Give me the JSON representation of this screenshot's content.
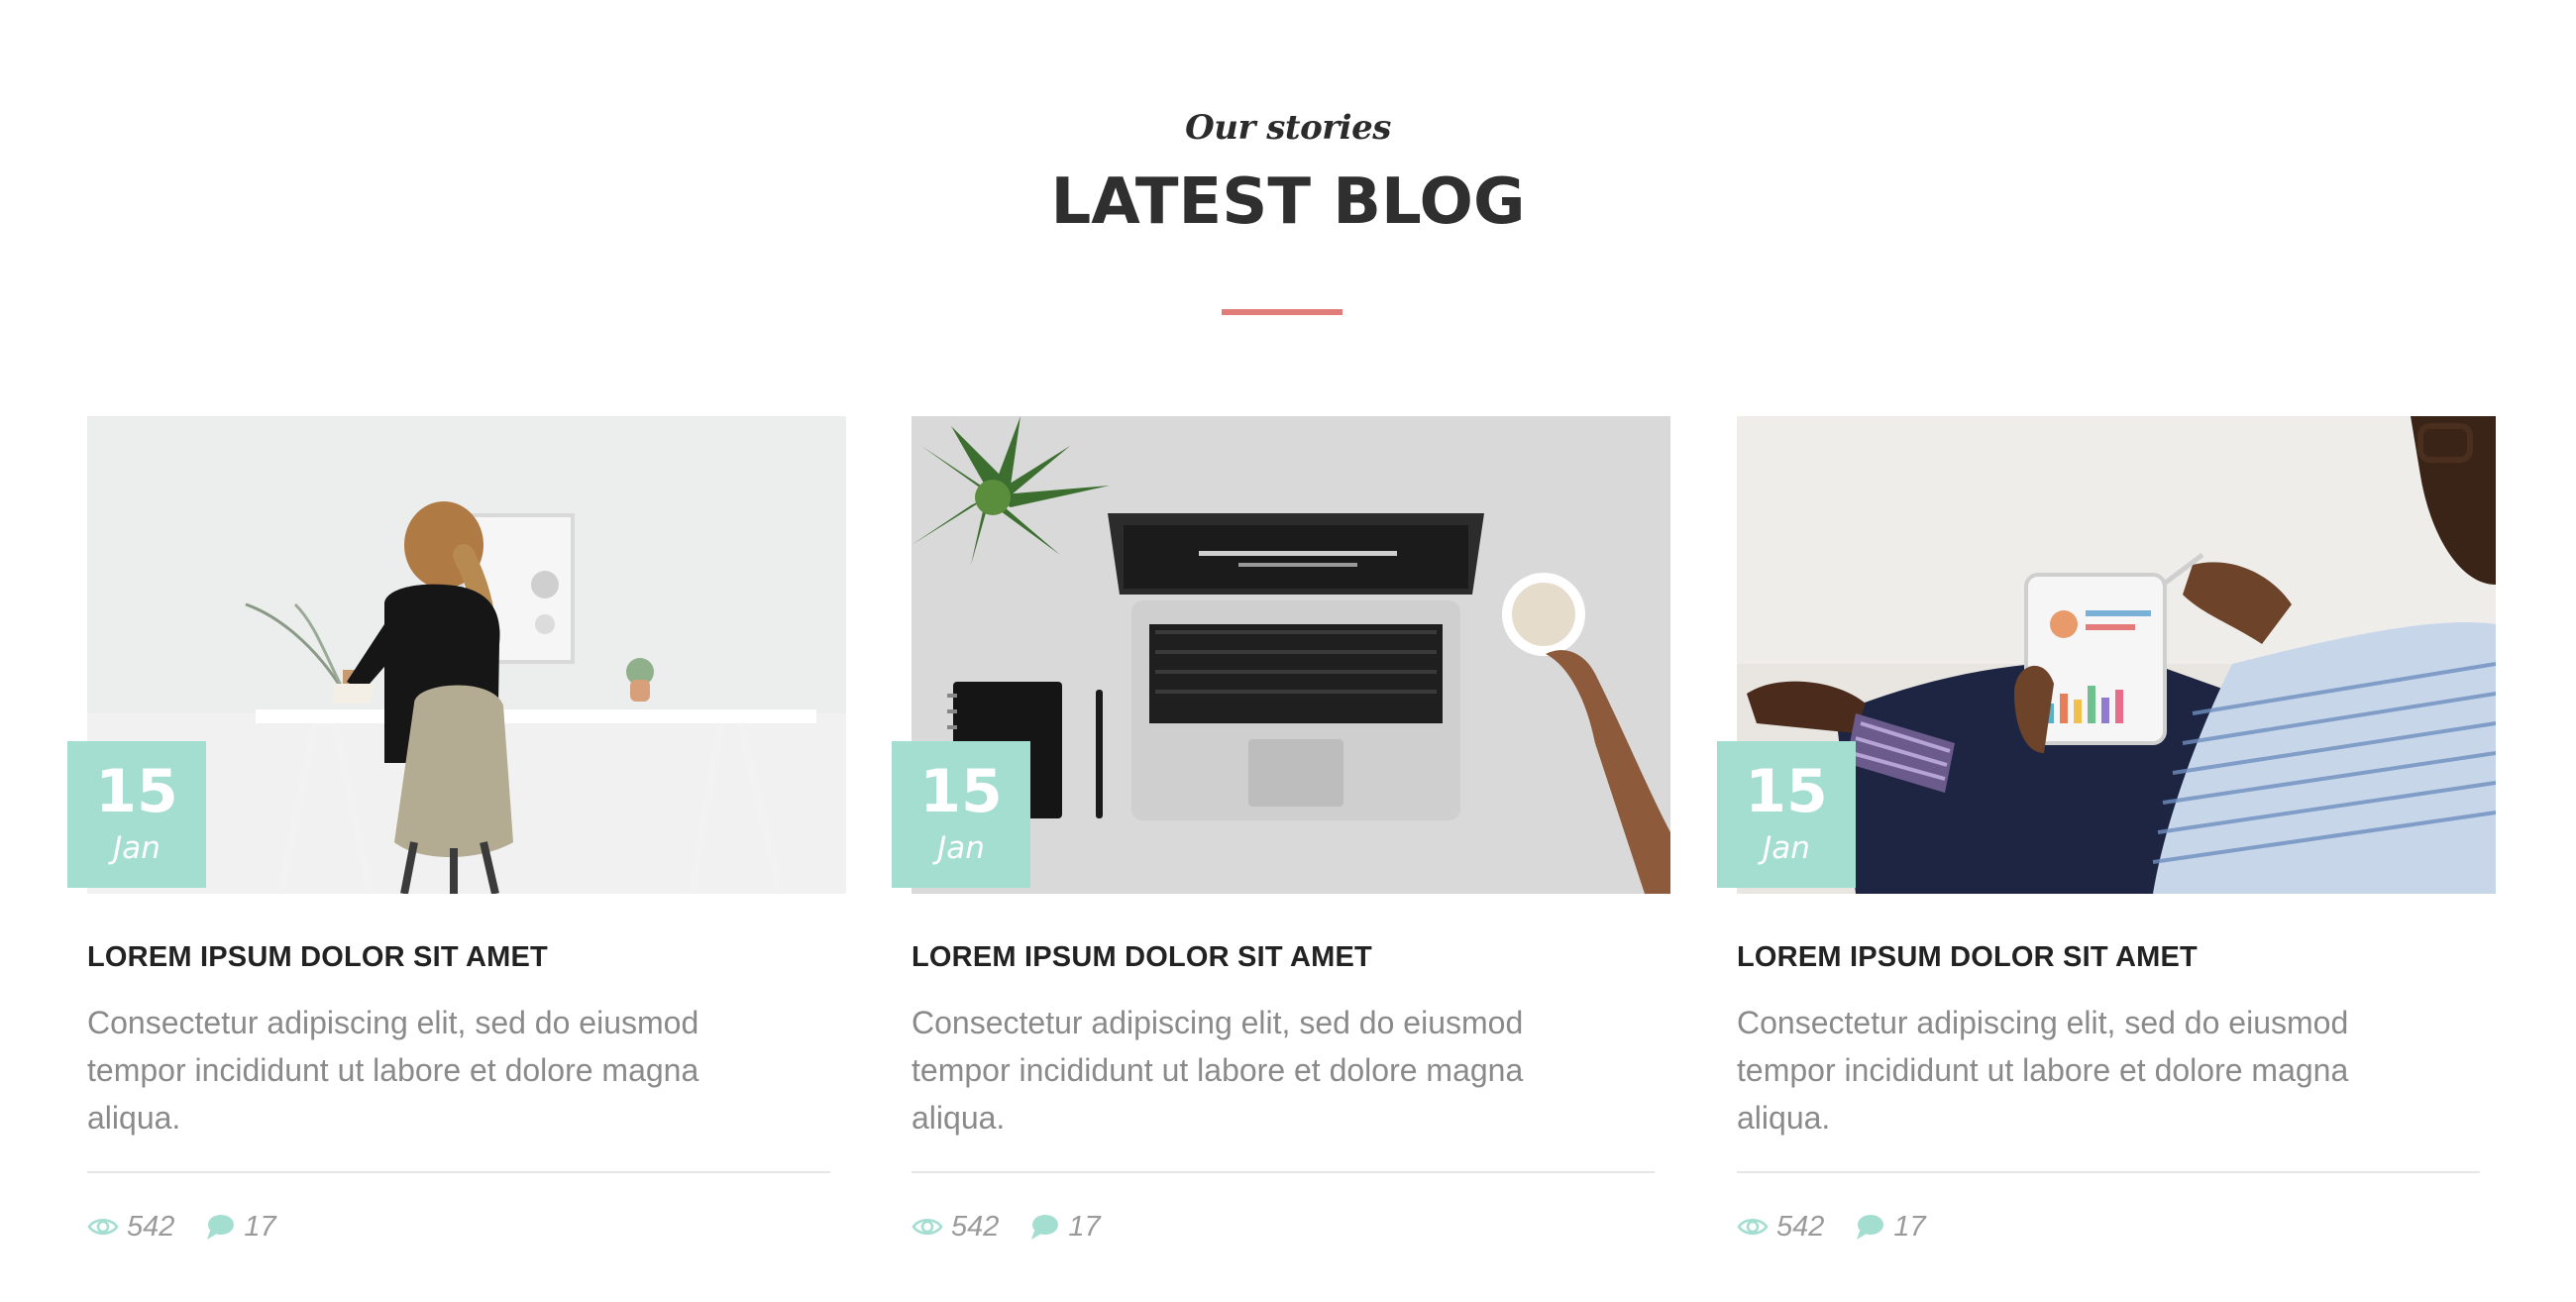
{
  "section": {
    "kicker": "Our stories",
    "title": "LATEST BLOG",
    "accent_color": "#e07d78",
    "badge_color": "#a4ded1"
  },
  "posts": [
    {
      "image": "woman-at-desk-photo",
      "date_day": "15",
      "date_month": "Jan",
      "title": "LOREM IPSUM DOLOR SIT AMET",
      "excerpt": "Consectetur adipiscing elit, sed do eiusmod tempor incididunt ut labore et dolore magna aliqua.",
      "views": "542",
      "comments": "17"
    },
    {
      "image": "laptop-on-desk-photo",
      "date_day": "15",
      "date_month": "Jan",
      "title": "LOREM IPSUM DOLOR SIT AMET",
      "excerpt": "Consectetur adipiscing elit, sed do eiusmod tempor incididunt ut labore et dolore magna aliqua.",
      "views": "542",
      "comments": "17"
    },
    {
      "image": "man-with-tablet-photo",
      "date_day": "15",
      "date_month": "Jan",
      "title": "LOREM IPSUM DOLOR SIT AMET",
      "excerpt": "Consectetur adipiscing elit, sed do eiusmod tempor incididunt ut labore et dolore magna aliqua.",
      "views": "542",
      "comments": "17"
    }
  ],
  "icons": {
    "views": "eye-icon",
    "comments": "speech-bubble-icon"
  }
}
